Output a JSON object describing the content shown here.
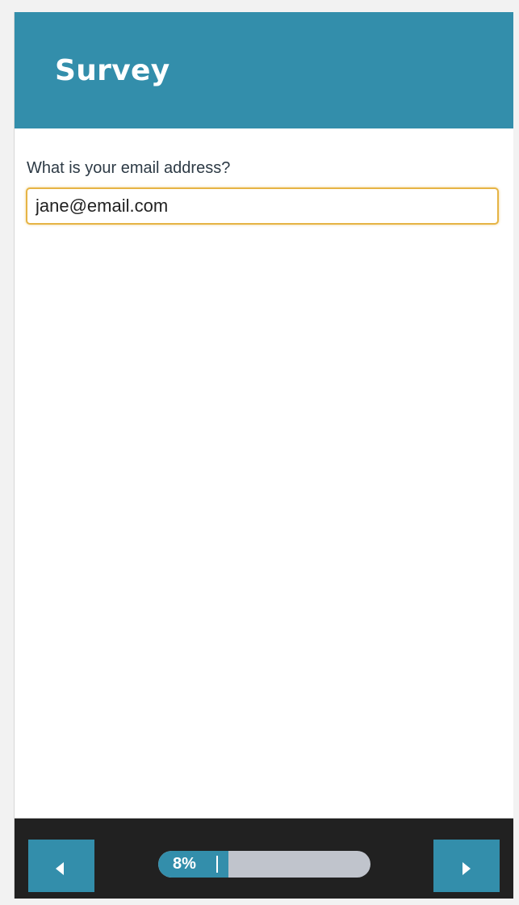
{
  "header": {
    "title": "Survey"
  },
  "question": {
    "label": "What is your email address?",
    "answer_value": "jane@email.com"
  },
  "footer": {
    "prev_icon": "triangle-left-icon",
    "next_icon": "triangle-right-icon",
    "progress": {
      "percent": 8,
      "label": "8%"
    }
  },
  "colors": {
    "brand": "#338eab",
    "focus_border": "#e6b445",
    "footer_bg": "#212121",
    "progress_track": "#c0c4cc"
  }
}
